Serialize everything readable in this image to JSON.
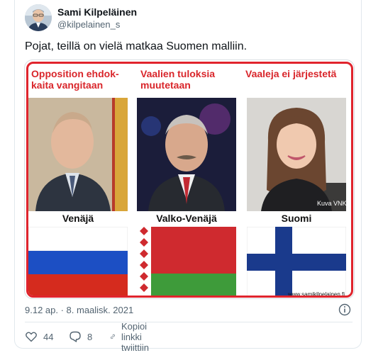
{
  "author": {
    "display_name": "Sami Kilpeläinen",
    "handle": "@kilpelainen_s"
  },
  "tweet": {
    "text": "Pojat, teillä on vielä matkaa Suomen malliin.",
    "timestamp": "9.12 ap. · 8. maalisk. 2021"
  },
  "image": {
    "panels": [
      {
        "heading": "Opposition ehdok-\nkaita vangitaan",
        "country": "Venäjä",
        "flag": "russia"
      },
      {
        "heading": "Vaalien tuloksia\nmuutetaan",
        "country": "Valko-Venäjä",
        "flag": "belarus"
      },
      {
        "heading": "Vaaleja ei järjestetä",
        "country": "Suomi",
        "flag": "finland"
      }
    ],
    "photo_credit": "Kuva VNK",
    "watermark": "www.samikilpelainen.fi"
  },
  "actions": {
    "likes": "44",
    "replies": "8",
    "copy_link_label": "Kopioi linkki twiittiin"
  },
  "colors": {
    "meme_accent": "#d9262b",
    "text_secondary": "#536471"
  }
}
